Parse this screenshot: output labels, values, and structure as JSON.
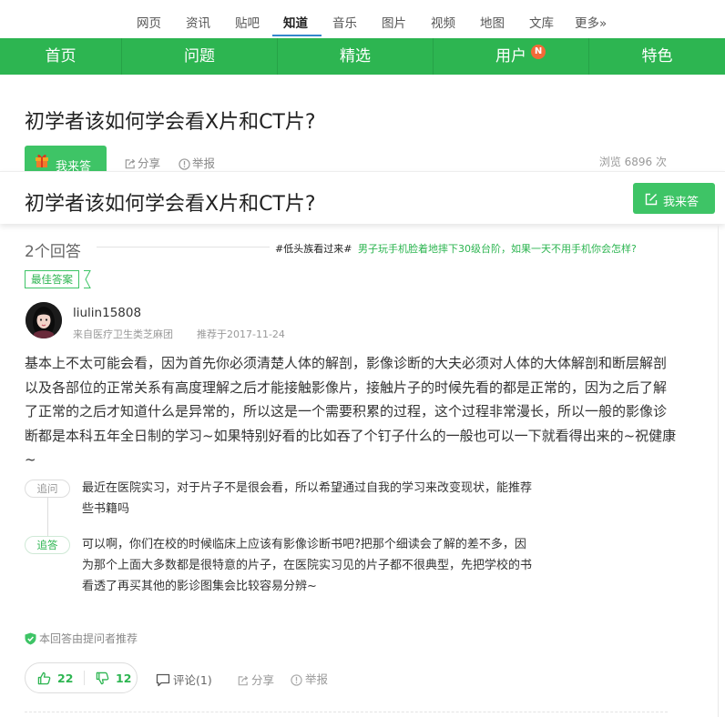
{
  "topnav": {
    "items": [
      "网页",
      "资讯",
      "贴吧",
      "知道",
      "音乐",
      "图片",
      "视频",
      "地图",
      "文库",
      "更多»"
    ],
    "active": "知道"
  },
  "greenbar": {
    "tabs": [
      "首页",
      "问题",
      "精选",
      "用户",
      "特色"
    ],
    "badge": "N"
  },
  "question": {
    "title": "初学者该如何学会看X片和CT片?",
    "answer_btn": "我来答",
    "share": "分享",
    "report": "举报",
    "views": "浏览 6896 次"
  },
  "sticky": {
    "title": "初学者该如何学会看X片和CT片?",
    "answer_btn": "我来答"
  },
  "answers": {
    "count": "2个回答",
    "hot_tag": "#低头族看过来#",
    "hot_link": "男子玩手机脸着地摔下30级台阶，如果一天不用手机你会怎样?"
  },
  "best": {
    "label": "最佳答案",
    "author": "liulin15808",
    "source": "来自医疗卫生类芝麻团",
    "date": "推荐于2017-11-24",
    "body": "基本上不太可能会看，因为首先你必须清楚人体的解剖，影像诊断的大夫必须对人体的大体解剖和断层解剖以及各部位的正常关系有高度理解之后才能接触影像片，接触片子的时候先看的都是正常的，因为之后了解了正常的之后才知道什么是异常的，所以这是一个需要积累的过程，这个过程非常漫长，所以一般的影像诊断都是本科五年全日制的学习~如果特别好看的比如吞了个钉子什么的一般也可以一下就看得出来的~祝健康~"
  },
  "followups": {
    "ask_label": "追问",
    "ask_text": "最近在医院实习，对于片子不是很会看，所以希望通过自我的学习来改变现状，能推荐些书籍吗",
    "reply_label": "追答",
    "reply_text": "可以啊，你们在校的时候临床上应该有影像诊断书吧?把那个细读会了解的差不多，因为那个上面大多数都是很特意的片子，在医院实习见的片子都不很典型，先把学校的书看透了再买其他的影诊图集会比较容易分辨~"
  },
  "recommended": "本回答由提问者推荐",
  "actions": {
    "up": "22",
    "down": "12",
    "comment": "评论(1)",
    "share": "分享",
    "report": "举报"
  },
  "colors": {
    "brand_green": "#2db551",
    "button_green": "#3ec466",
    "badge_orange": "#f36a38",
    "link_blue": "#3388cc"
  }
}
